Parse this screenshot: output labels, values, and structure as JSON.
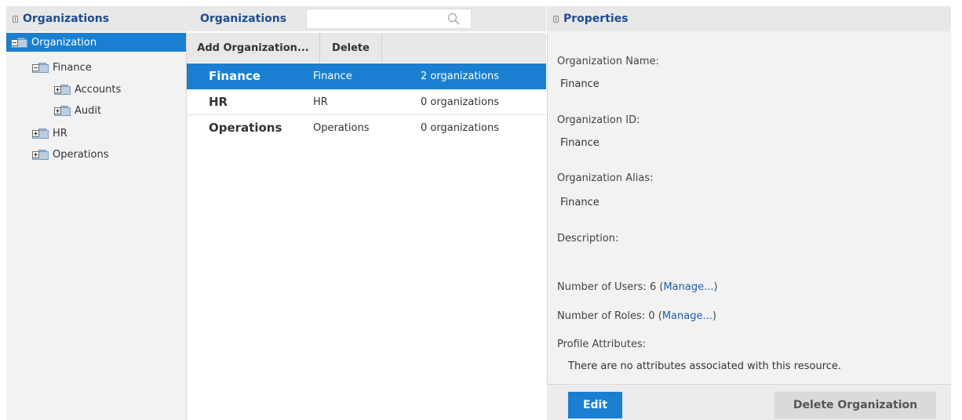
{
  "left_panel": {
    "title": "Organizations",
    "tree": [
      {
        "label": "Organization",
        "selected": true
      },
      {
        "label": "Finance"
      },
      {
        "label": "Accounts"
      },
      {
        "label": "Audit"
      },
      {
        "label": "HR"
      },
      {
        "label": "Operations"
      }
    ]
  },
  "middle_panel": {
    "title": "Organizations",
    "search": {
      "value": "",
      "placeholder": ""
    },
    "toolbar": {
      "add_label": "Add Organization...",
      "delete_label": "Delete"
    },
    "rows": [
      {
        "name": "Finance",
        "id": "Finance",
        "count": "2 organizations",
        "selected": true
      },
      {
        "name": "HR",
        "id": "HR",
        "count": "0 organizations"
      },
      {
        "name": "Operations",
        "id": "Operations",
        "count": "0 organizations"
      }
    ]
  },
  "right_panel": {
    "title": "Properties",
    "org_name_label": "Organization Name:",
    "org_name_value": "Finance",
    "org_id_label": "Organization ID:",
    "org_id_value": "Finance",
    "org_alias_label": "Organization Alias:",
    "org_alias_value": "Finance",
    "description_label": "Description:",
    "users_label": "Number of Users:",
    "users_count": "6",
    "roles_label": "Number of Roles:",
    "roles_count": "0",
    "manage_link": "Manage...",
    "profile_label": "Profile Attributes:",
    "no_attributes_text": "There are no attributes associated with this resource.",
    "edit_label": "Edit",
    "delete_org_label": "Delete Organization"
  },
  "colors": {
    "accent": "#1a7fd0",
    "header_title": "#1f4d8f",
    "link": "#1f5fa8"
  },
  "icons": [
    "collapse-icon",
    "folder-minus-icon",
    "folder-plus-icon",
    "search-icon"
  ]
}
